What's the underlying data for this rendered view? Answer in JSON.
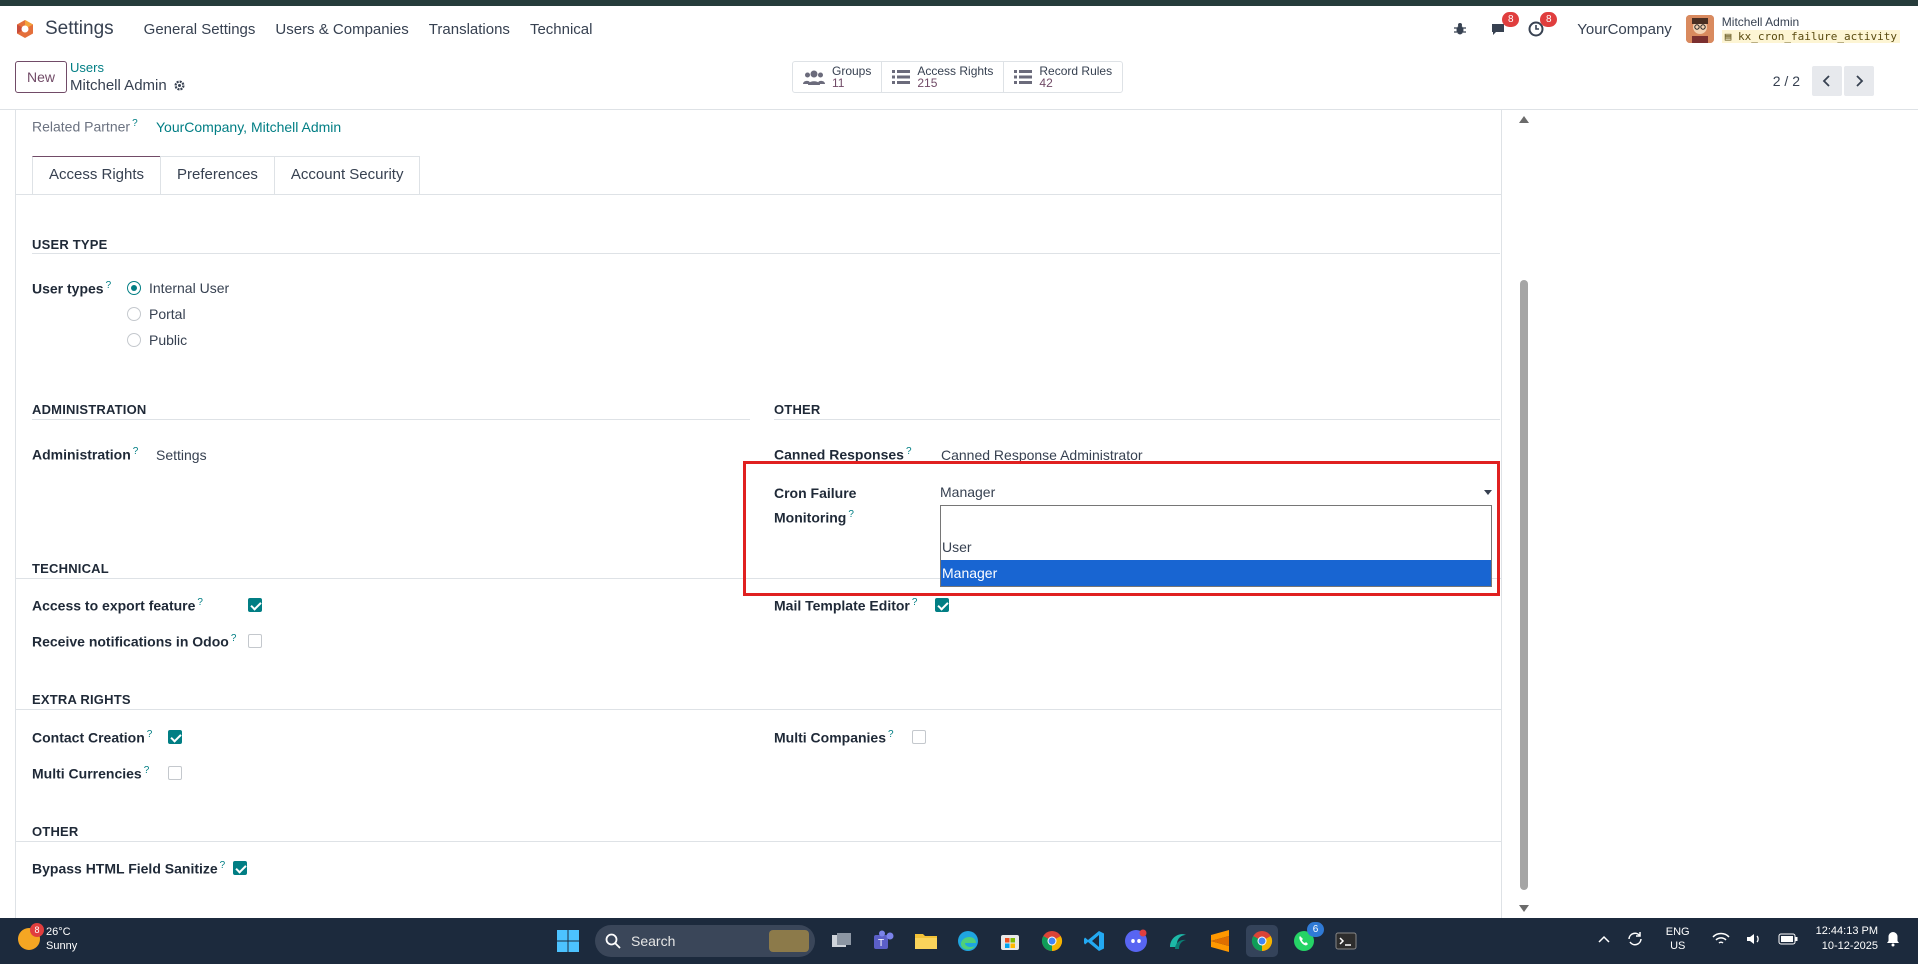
{
  "navbar": {
    "app_name": "Settings",
    "menu": [
      "General Settings",
      "Users & Companies",
      "Translations",
      "Technical"
    ],
    "chat_badge": "8",
    "activity_badge": "8",
    "company": "YourCompany",
    "user_name": "Mitchell Admin",
    "db_name": "kx_cron_failure_activity"
  },
  "control": {
    "new_label": "New",
    "breadcrumb_parent": "Users",
    "breadcrumb_current": "Mitchell Admin",
    "stats": [
      {
        "label": "Groups",
        "value": "11",
        "icon": "users-icon"
      },
      {
        "label": "Access Rights",
        "value": "215",
        "icon": "list-icon"
      },
      {
        "label": "Record Rules",
        "value": "42",
        "icon": "list-icon"
      }
    ],
    "pager": "2 / 2"
  },
  "form": {
    "related_partner_label": "Related Partner",
    "related_partner_value": "YourCompany, Mitchell Admin",
    "tabs": [
      "Access Rights",
      "Preferences",
      "Account Security"
    ],
    "user_type_section": "USER TYPE",
    "user_types_label": "User types",
    "user_type_options": [
      "Internal User",
      "Portal",
      "Public"
    ],
    "administration_section": "ADMINISTRATION",
    "administration_label": "Administration",
    "administration_value": "Settings",
    "other_section": "OTHER",
    "canned_label": "Canned Responses",
    "canned_value": "Canned Response Administrator",
    "cron_label_1": "Cron Failure",
    "cron_label_2": "Monitoring",
    "cron_value": "Manager",
    "cron_options": [
      "",
      "User",
      "Manager"
    ],
    "technical_section": "TECHNICAL",
    "export_label": "Access to export feature",
    "notif_label": "Receive notifications in Odoo",
    "mail_template_label": "Mail Template Editor",
    "extra_section": "EXTRA RIGHTS",
    "contact_label": "Contact Creation",
    "multi_currencies_label": "Multi Currencies",
    "multi_companies_label": "Multi Companies",
    "other2_section": "OTHER",
    "bypass_label": "Bypass HTML Field Sanitize",
    "help_mark": "?"
  },
  "taskbar": {
    "weather_temp": "26°C",
    "weather_desc": "Sunny",
    "weather_badge": "8",
    "search_placeholder": "Search",
    "teams_badge": "6",
    "lang_1": "ENG",
    "lang_2": "US",
    "time": "12:44:13 PM",
    "date": "10-12-2025"
  },
  "colors": {
    "accent": "#714b67",
    "link": "#017e84",
    "highlight": "#e02020",
    "option_selected": "#1865d2"
  }
}
